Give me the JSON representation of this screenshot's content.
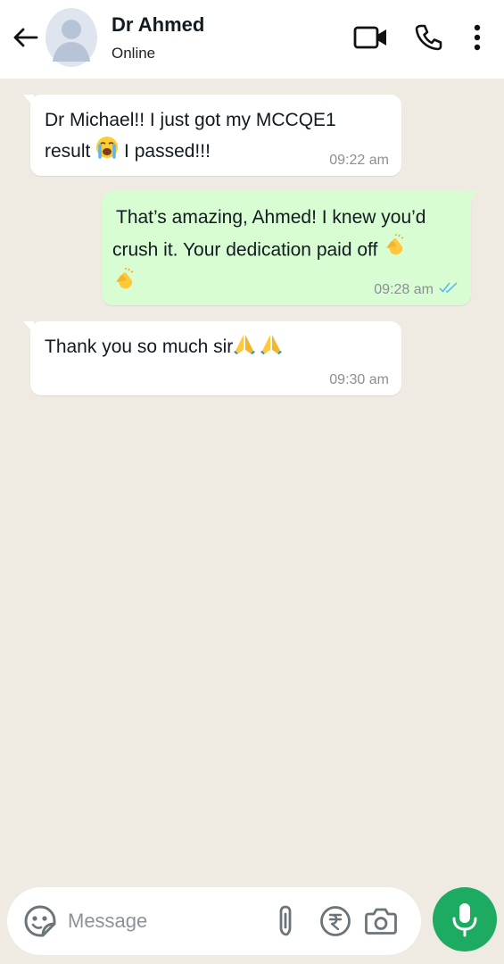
{
  "header": {
    "contact_name": "Dr Ahmed",
    "status": "Online",
    "icons": [
      "back-arrow-icon",
      "video-call-icon",
      "voice-call-icon",
      "more-options-icon"
    ]
  },
  "messages": [
    {
      "direction": "incoming",
      "line1": "Dr Michael!! I just got my MCCQE1",
      "line2a": "result",
      "emoji": "loudly-crying-face",
      "line2b": "I passed!!!",
      "time": "09:22 am"
    },
    {
      "direction": "outgoing",
      "line1": "That’s amazing, Ahmed! I knew you’d",
      "line2": "crush it. Your dedication paid off",
      "emoji": "clapping-hands",
      "time": "09:28 am",
      "read_status": "read",
      "tick_color": "#53bdeb"
    },
    {
      "direction": "incoming",
      "text": "Thank you so much sir",
      "emoji": "folded-hands",
      "time": "09:30 am"
    }
  ],
  "composer": {
    "placeholder": "Message",
    "icons": [
      "sticker-icon",
      "attach-icon",
      "rupee-payment-icon",
      "camera-icon",
      "mic-icon"
    ]
  },
  "colors": {
    "chat_background": "#efeae2",
    "incoming_bubble": "#ffffff",
    "outgoing_bubble": "#d9fdd3",
    "accent_green": "#1daa61"
  }
}
